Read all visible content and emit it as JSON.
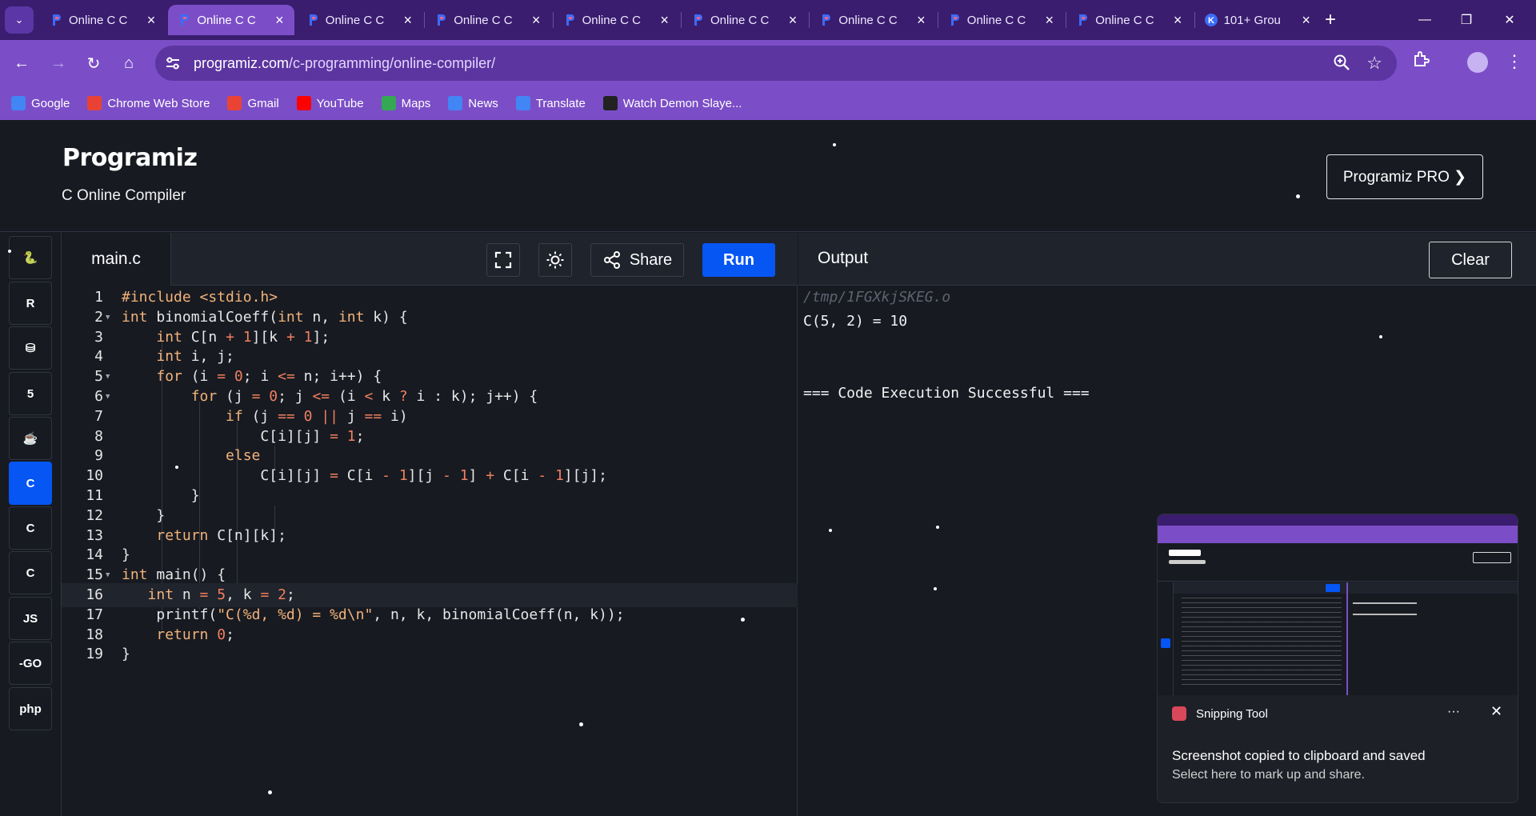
{
  "browser": {
    "tabs": [
      {
        "title": "Online C C",
        "favicon": "programiz-icon",
        "active": false
      },
      {
        "title": "Online C C",
        "favicon": "programiz-icon",
        "active": true
      },
      {
        "title": "Online C C",
        "favicon": "programiz-icon",
        "active": false
      },
      {
        "title": "Online C C",
        "favicon": "programiz-icon",
        "active": false
      },
      {
        "title": "Online C C",
        "favicon": "programiz-icon",
        "active": false
      },
      {
        "title": "Online C C",
        "favicon": "programiz-icon",
        "active": false
      },
      {
        "title": "Online C C",
        "favicon": "programiz-icon",
        "active": false
      },
      {
        "title": "Online C C",
        "favicon": "programiz-icon",
        "active": false
      },
      {
        "title": "Online C C",
        "favicon": "programiz-icon",
        "active": false
      },
      {
        "title": "101+ Grou",
        "favicon": "k-icon",
        "active": false
      }
    ],
    "url_host": "programiz.com",
    "url_path": "/c-programming/online-compiler/",
    "bookmarks": [
      {
        "label": "Google",
        "icon": "google-icon",
        "color": "#4285f4"
      },
      {
        "label": "Chrome Web Store",
        "icon": "chrome-web-store-icon",
        "color": "#e94235"
      },
      {
        "label": "Gmail",
        "icon": "gmail-icon",
        "color": "#ea4335"
      },
      {
        "label": "YouTube",
        "icon": "youtube-icon",
        "color": "#ff0000"
      },
      {
        "label": "Maps",
        "icon": "maps-icon",
        "color": "#34a853"
      },
      {
        "label": "News",
        "icon": "news-icon",
        "color": "#4285f4"
      },
      {
        "label": "Translate",
        "icon": "translate-icon",
        "color": "#4285f4"
      },
      {
        "label": "Watch Demon Slaye...",
        "icon": "hianime-icon",
        "color": "#222222"
      }
    ]
  },
  "site": {
    "logo": "Programiz",
    "subtitle": "C Online Compiler",
    "pro_button": "Programiz PRO ❯"
  },
  "sidebar": {
    "languages": [
      {
        "name": "python-lang-button",
        "glyph": "🐍",
        "active": false
      },
      {
        "name": "r-lang-button",
        "glyph": "R",
        "active": false
      },
      {
        "name": "sql-lang-button",
        "glyph": "⛁",
        "active": false
      },
      {
        "name": "html-lang-button",
        "glyph": "5",
        "active": false
      },
      {
        "name": "java-lang-button",
        "glyph": "☕",
        "active": false
      },
      {
        "name": "c-lang-button",
        "glyph": "C",
        "active": true
      },
      {
        "name": "cpp-lang-button",
        "glyph": "C",
        "active": false
      },
      {
        "name": "csharp-lang-button",
        "glyph": "C",
        "active": false
      },
      {
        "name": "js-lang-button",
        "glyph": "JS",
        "active": false
      },
      {
        "name": "go-lang-button",
        "glyph": "-GO",
        "active": false
      },
      {
        "name": "php-lang-button",
        "glyph": "php",
        "active": false
      }
    ]
  },
  "editor": {
    "filename": "main.c",
    "share_label": "Share",
    "run_label": "Run",
    "lines": [
      "#include <stdio.h>",
      "int binomialCoeff(int n, int k) {",
      "    int C[n + 1][k + 1];",
      "    int i, j;",
      "    for (i = 0; i <= n; i++) {",
      "        for (j = 0; j <= (i < k ? i : k); j++) {",
      "            if (j == 0 || j == i)",
      "                C[i][j] = 1;",
      "            else",
      "                C[i][j] = C[i - 1][j - 1] + C[i - 1][j];",
      "        }",
      "    }",
      "    return C[n][k];",
      "}",
      "int main() {",
      "   int n = 5, k = 2;",
      "    printf(\"C(%d, %d) = %d\\n\", n, k, binomialCoeff(n, k));",
      "    return 0;",
      "}"
    ],
    "fold_lines": [
      2,
      5,
      6,
      15
    ],
    "active_line": 16
  },
  "output": {
    "title": "Output",
    "clear_label": "Clear",
    "path": "/tmp/1FGXkjSKEG.o",
    "result": "C(5, 2) = 10",
    "status": "=== Code Execution Successful ==="
  },
  "notification": {
    "app": "Snipping Tool",
    "more": "···",
    "message": "Screenshot copied to clipboard and saved",
    "sub": "Select here to mark up and share."
  }
}
